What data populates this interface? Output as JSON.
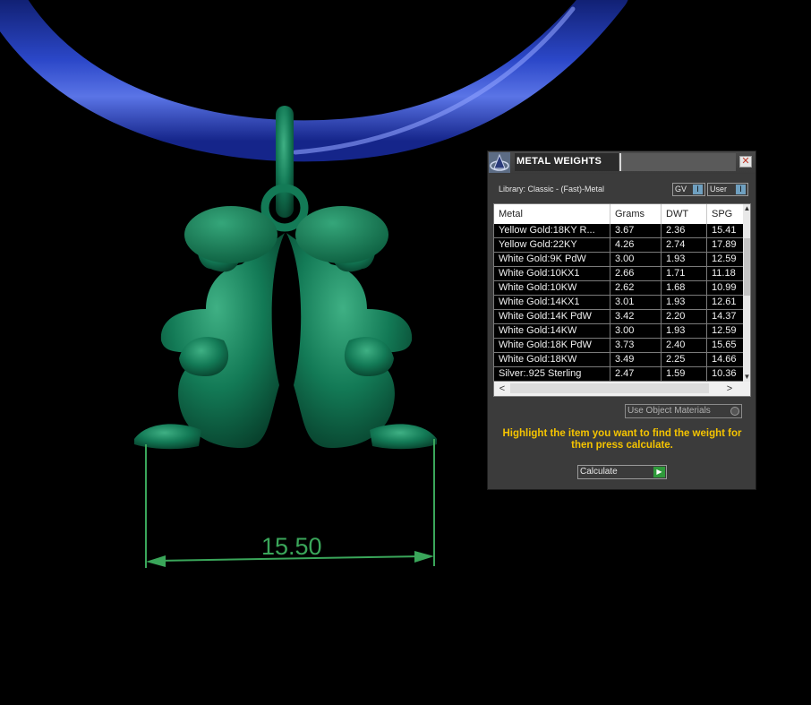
{
  "scene": {
    "dimension_label": "15.50",
    "colors": {
      "pendant": "#137a56",
      "cord": "#1e35a6",
      "dimension": "#3aa65a",
      "background": "#000000"
    }
  },
  "panel": {
    "title": "METAL WEIGHTS",
    "close_label": "✕",
    "logo_icon": "app-logo-icon",
    "library_label": "Library: Classic - (Fast)-Metal",
    "toggle_gv": "GV",
    "toggle_user": "User",
    "toggle_knob": "I",
    "columns": [
      "Metal",
      "Grams",
      "DWT",
      "SPG"
    ],
    "rows": [
      [
        "Yellow Gold:18KY R...",
        "3.67",
        "2.36",
        "15.41"
      ],
      [
        "Yellow Gold:22KY",
        "4.26",
        "2.74",
        "17.89"
      ],
      [
        "White Gold:9K PdW",
        "3.00",
        "1.93",
        "12.59"
      ],
      [
        "White Gold:10KX1",
        "2.66",
        "1.71",
        "11.18"
      ],
      [
        "White Gold:10KW",
        "2.62",
        "1.68",
        "10.99"
      ],
      [
        "White Gold:14KX1",
        "3.01",
        "1.93",
        "12.61"
      ],
      [
        "White Gold:14K PdW",
        "3.42",
        "2.20",
        "14.37"
      ],
      [
        "White Gold:14KW",
        "3.00",
        "1.93",
        "12.59"
      ],
      [
        "White Gold:18K PdW",
        "3.73",
        "2.40",
        "15.65"
      ],
      [
        "White Gold:18KW",
        "3.49",
        "2.25",
        "14.66"
      ],
      [
        "Silver:.925 Sterling",
        "2.47",
        "1.59",
        "10.36"
      ]
    ],
    "use_object_materials": "Use Object Materials",
    "instructions": "Highlight the item you want to find the weight for then press calculate.",
    "calculate_label": "Calculate",
    "colors": {
      "panel_bg": "#3b3b3b",
      "instructions": "#f5c400",
      "go_button": "#2f9a3b"
    }
  }
}
